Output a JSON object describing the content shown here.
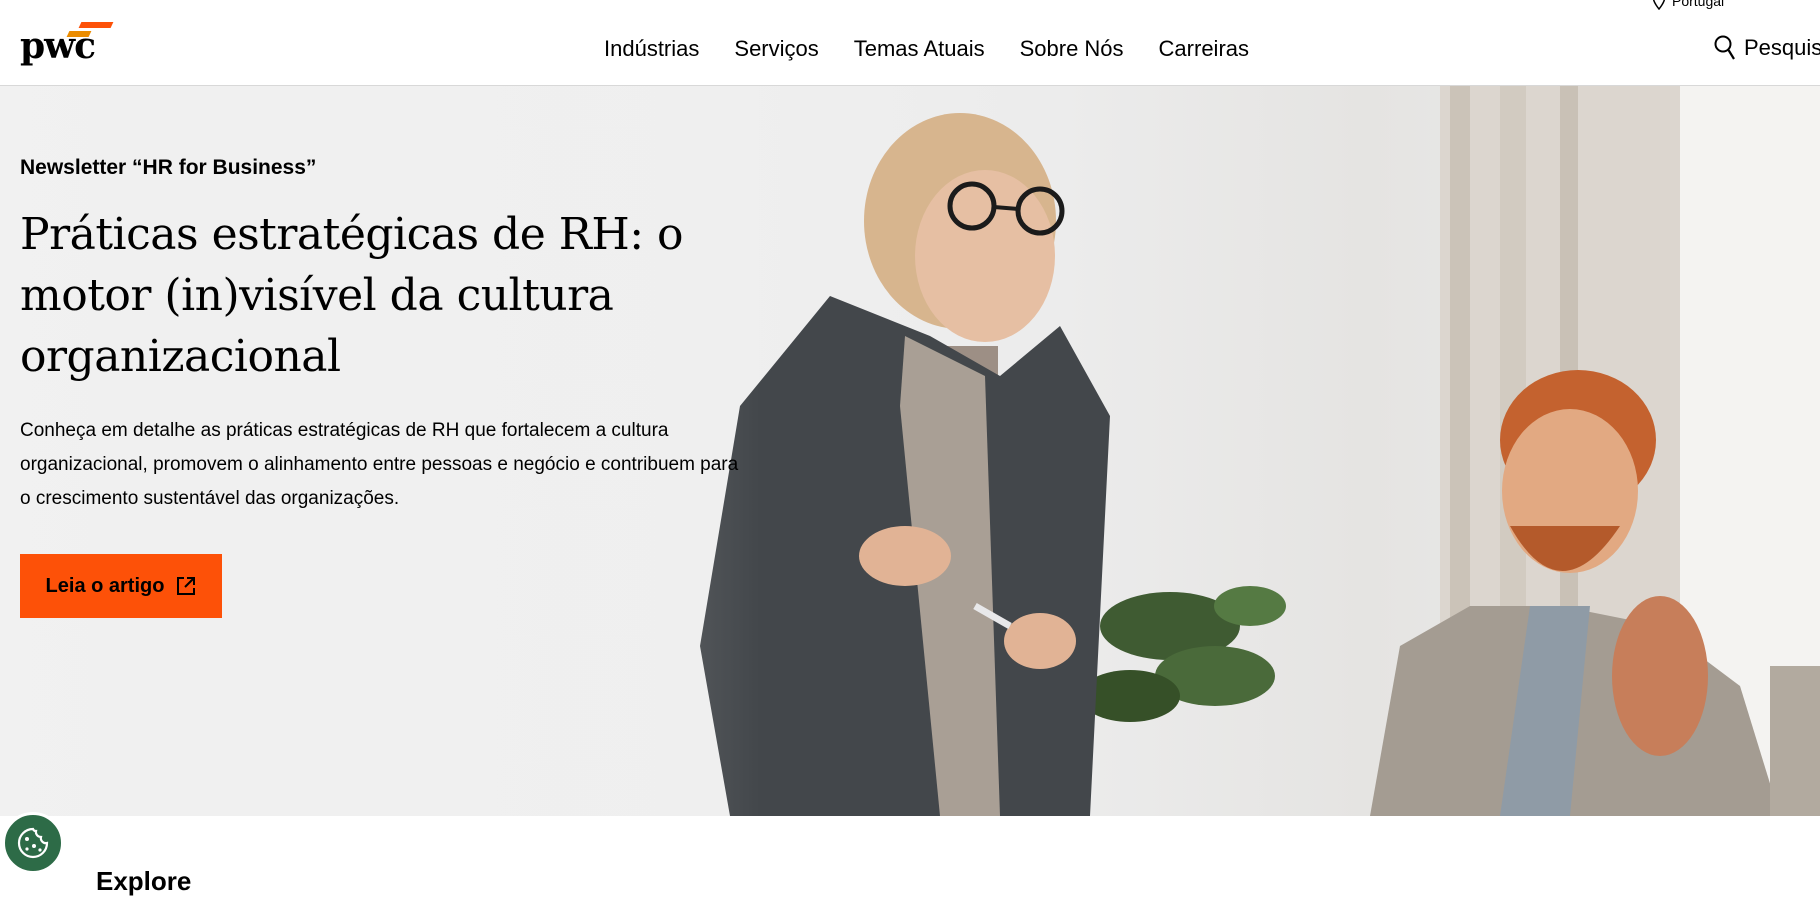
{
  "brand": {
    "logo_text": "pwc"
  },
  "header": {
    "locale_label": "Portugal",
    "nav": [
      "Indústrias",
      "Serviços",
      "Temas Atuais",
      "Sobre Nós",
      "Carreiras"
    ],
    "search_label": "Pesquis"
  },
  "hero": {
    "eyebrow": "Newsletter “HR for Business”",
    "headline": "Práticas estratégicas de RH: o motor (in)visível da cultura organizacional",
    "lead": "Conheça em detalhe as práticas estratégicas de RH que fortalecem a cultura organizacional, promovem o alinhamento entre pessoas e negócio e contribuem para o crescimento sustentável das organizações.",
    "cta_label": "Leia o artigo"
  },
  "below": {
    "heading_partial": "Explore"
  },
  "colors": {
    "accent": "#fd5108",
    "brand_yellow": "#eb8c00",
    "cookie_bg": "#2d6b47"
  },
  "icons": [
    "location-pin-icon",
    "search-icon",
    "external-link-icon",
    "cookie-icon"
  ]
}
